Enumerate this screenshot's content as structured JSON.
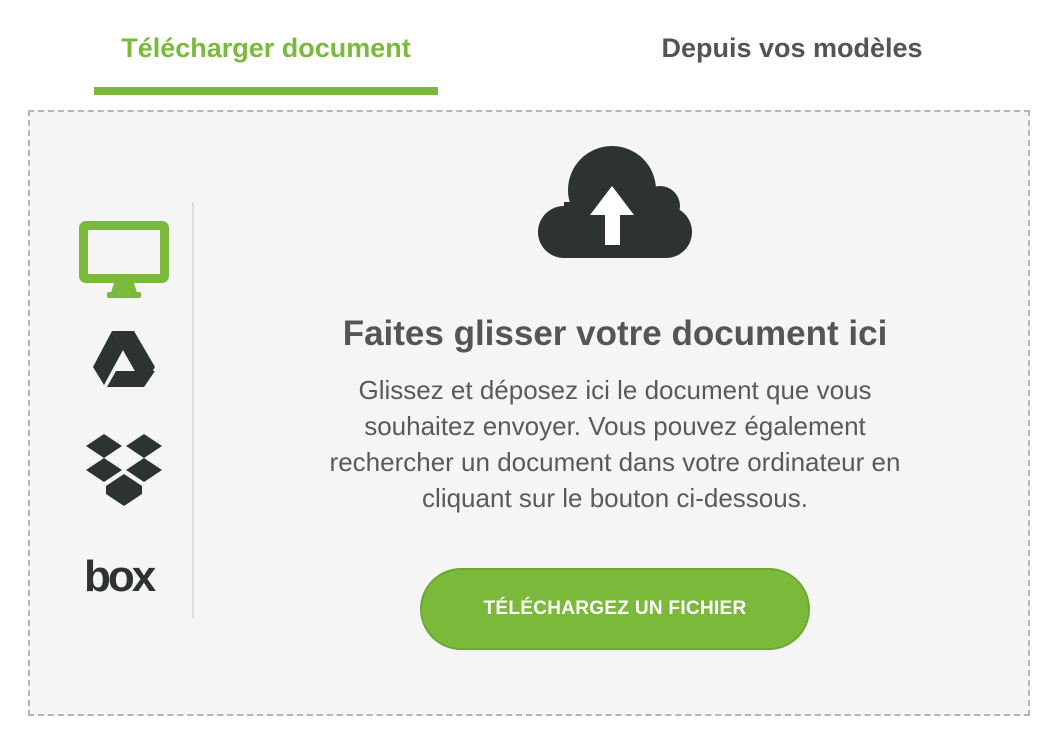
{
  "tabs": {
    "upload_label": "Télécharger document",
    "templates_label": "Depuis vos modèles"
  },
  "sources": [
    "computer-icon",
    "google-drive-icon",
    "dropbox-icon",
    "box-icon"
  ],
  "box_logo_text": "box",
  "dropzone": {
    "icon": "cloud-upload-icon",
    "title": "Faites glisser votre document ici",
    "description": "Glissez et déposez ici le document que vous souhaitez envoyer. Vous pouvez également rechercher un document dans votre ordinateur en cliquant sur le bouton ci-dessous.",
    "button_label": "TÉLÉCHARGEZ UN FICHIER"
  },
  "colors": {
    "accent": "#7ab93a",
    "icon_dark": "#2d332e",
    "text": "#555555",
    "dropzone_bg": "#f5f5f5"
  }
}
